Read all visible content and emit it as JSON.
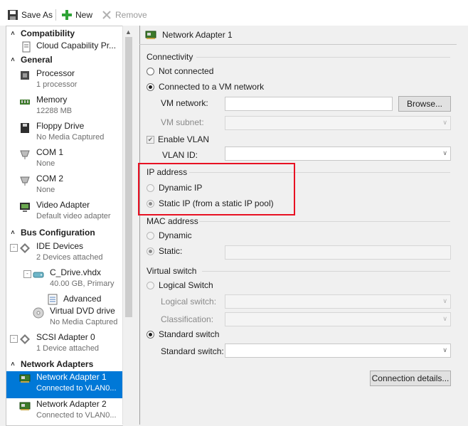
{
  "toolbar": {
    "save_as": "Save As",
    "new": "New",
    "remove": "Remove"
  },
  "sidebar": {
    "sections": {
      "compatibility": "Compatibility",
      "general": "General",
      "bus": "Bus Configuration",
      "network": "Network Adapters"
    },
    "items": {
      "cloud": {
        "title": "Cloud Capability Pr..."
      },
      "processor": {
        "title": "Processor",
        "sub": "1 processor"
      },
      "memory": {
        "title": "Memory",
        "sub": "12288 MB"
      },
      "floppy": {
        "title": "Floppy Drive",
        "sub": "No Media Captured"
      },
      "com1": {
        "title": "COM 1",
        "sub": "None"
      },
      "com2": {
        "title": "COM 2",
        "sub": "None"
      },
      "video": {
        "title": "Video Adapter",
        "sub": "Default video adapter"
      },
      "ide": {
        "title": "IDE Devices",
        "sub": "2 Devices attached"
      },
      "cdrive": {
        "title": "C_Drive.vhdx",
        "sub": "40.00 GB, Primary"
      },
      "advanced": {
        "title": "Advanced"
      },
      "dvd": {
        "title": "Virtual DVD drive",
        "sub": "No Media Captured"
      },
      "scsi": {
        "title": "SCSI Adapter 0",
        "sub": "1 Device attached"
      },
      "nic1": {
        "title": "Network Adapter 1",
        "sub": "Connected to VLAN0..."
      },
      "nic2": {
        "title": "Network Adapter 2",
        "sub": "Connected to VLAN0..."
      }
    }
  },
  "panel": {
    "title": "Network Adapter 1",
    "connectivity": {
      "label": "Connectivity",
      "not_connected": "Not connected",
      "connected_vm": "Connected to a VM network",
      "vm_network_label": "VM network:",
      "vm_network_value": "",
      "browse": "Browse...",
      "vm_subnet_label": "VM subnet:",
      "enable_vlan": "Enable VLAN",
      "vlan_id_label": "VLAN ID:",
      "vlan_id_value": ""
    },
    "ip": {
      "label": "IP address",
      "dynamic": "Dynamic IP",
      "static": "Static IP (from a static IP pool)"
    },
    "mac": {
      "label": "MAC address",
      "dynamic": "Dynamic",
      "static": "Static:",
      "static_value": ""
    },
    "vswitch": {
      "label": "Virtual switch",
      "logical": "Logical Switch",
      "logical_switch_label": "Logical switch:",
      "classification_label": "Classification:",
      "standard": "Standard switch",
      "standard_switch_label": "Standard switch:",
      "standard_switch_value": ""
    },
    "connection_details": "Connection details..."
  },
  "colors": {
    "selection": "#0078d7",
    "highlight_box": "#e81123"
  }
}
